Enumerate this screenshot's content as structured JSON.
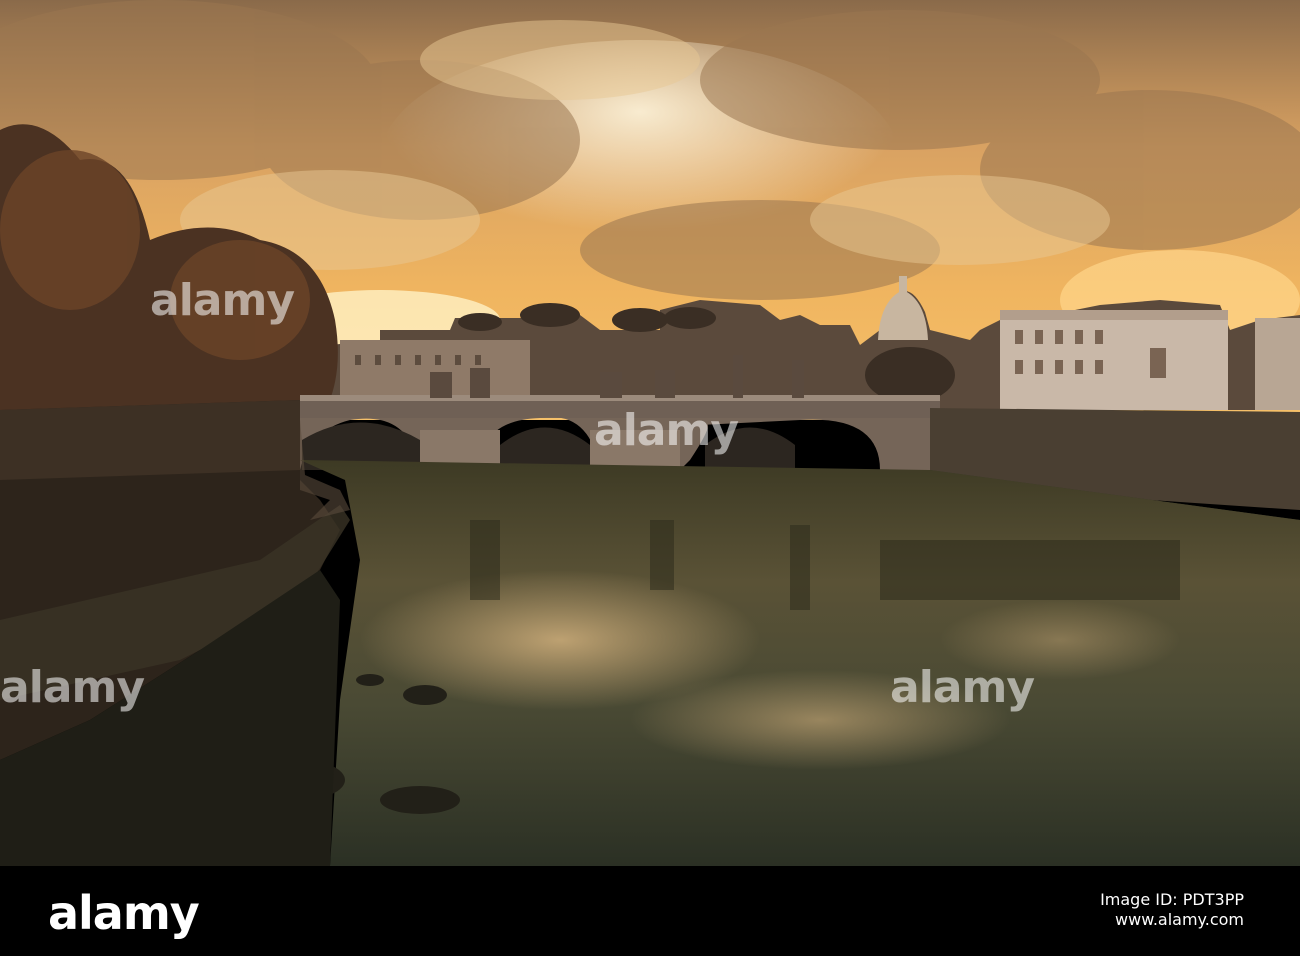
{
  "watermark": {
    "text": "alamy"
  },
  "footer": {
    "logo": "alamy",
    "image_id": "Image ID: PDT3PP",
    "site": "www.alamy.com"
  }
}
